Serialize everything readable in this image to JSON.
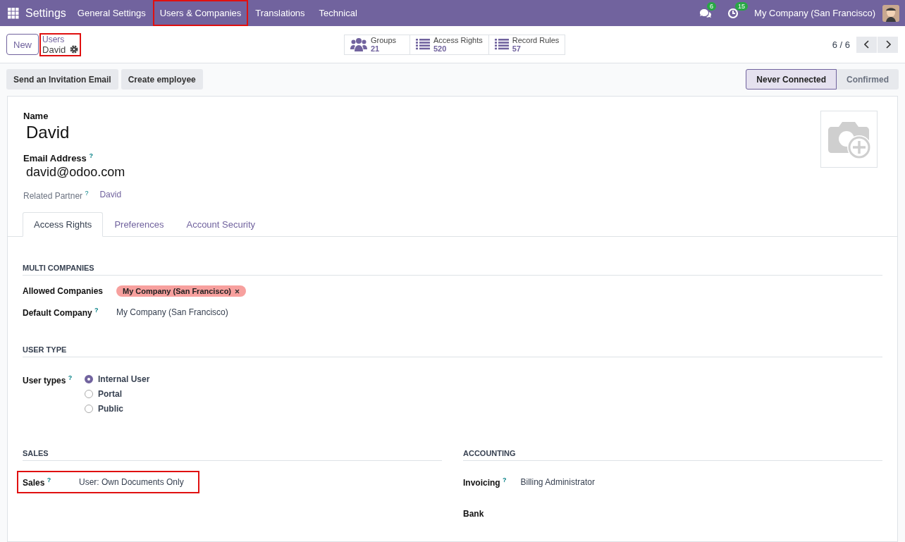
{
  "navbar": {
    "app_title": "Settings",
    "menu": [
      {
        "label": "General Settings",
        "highlighted": false
      },
      {
        "label": "Users & Companies",
        "highlighted": true
      },
      {
        "label": "Translations",
        "highlighted": false
      },
      {
        "label": "Technical",
        "highlighted": false
      }
    ],
    "messages_count": "6",
    "activities_count": "15",
    "company": "My Company (San Francisco)"
  },
  "control_panel": {
    "new_button": "New",
    "breadcrumb": {
      "parent": "Users",
      "current": "David",
      "highlighted": true
    },
    "smart_buttons": [
      {
        "kind": "users",
        "label": "Groups",
        "value": "21"
      },
      {
        "kind": "list",
        "label": "Access Rights",
        "value": "520"
      },
      {
        "kind": "list",
        "label": "Record Rules",
        "value": "57"
      }
    ],
    "pager": "6 / 6"
  },
  "actions": [
    "Send an Invitation Email",
    "Create employee"
  ],
  "statusbar": [
    {
      "label": "Never Connected",
      "selected": true
    },
    {
      "label": "Confirmed",
      "selected": false
    }
  ],
  "form": {
    "name_label": "Name",
    "name": "David",
    "email_label": "Email Address $^{?}$",
    "email": "david@odoo.com",
    "related_partner_label": "Related Partner $^{?}$",
    "related_partner": "David",
    "tabs": [
      {
        "label": "Access Rights",
        "selected": true
      },
      {
        "label": "Preferences",
        "selected": false
      },
      {
        "label": "Account Security",
        "selected": false
      }
    ],
    "multi_companies": {
      "title": "MULTI COMPANIES",
      "fields": [
        {
          "kind": "tags",
          "label": "Allowed Companies",
          "tags": [
            {
              "label": "My Company (San Francisco)",
              "color": "#f7a09e"
            }
          ]
        },
        {
          "kind": "text",
          "label": "Default Company $^{?}$",
          "value": "My Company (San Francisco)"
        }
      ]
    },
    "user_type": {
      "title": "USER TYPE",
      "label": "User types $^{?}$",
      "options": [
        {
          "label": "Internal User",
          "selected": true
        },
        {
          "label": "Portal",
          "selected": false
        },
        {
          "label": "Public",
          "selected": false
        }
      ]
    },
    "columns": [
      {
        "title": "SALES",
        "fields": [
          {
            "label": "Sales $^{?}$",
            "value": "User: Own Documents Only",
            "highlighted": true
          }
        ]
      },
      {
        "title": "ACCOUNTING",
        "fields": [
          {
            "label": "Invoicing $^{?}$",
            "value": "Billing Administrator",
            "highlighted": false
          },
          {
            "label": "Bank",
            "highlighted": false
          }
        ]
      }
    ]
  }
}
